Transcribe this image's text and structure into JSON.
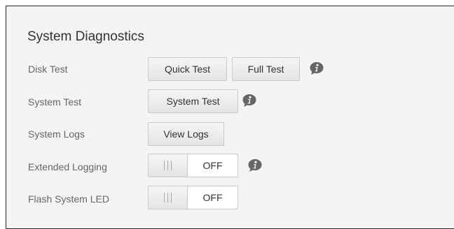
{
  "panel": {
    "title": "System Diagnostics"
  },
  "rows": {
    "disk_test": {
      "label": "Disk Test",
      "quick_test_label": "Quick Test",
      "full_test_label": "Full Test",
      "info_icon": "info-icon"
    },
    "system_test": {
      "label": "System Test",
      "button_label": "System Test",
      "info_icon": "info-icon"
    },
    "system_logs": {
      "label": "System Logs",
      "button_label": "View Logs"
    },
    "extended_logging": {
      "label": "Extended Logging",
      "state": "OFF",
      "info_icon": "info-icon"
    },
    "flash_system_led": {
      "label": "Flash System LED",
      "state": "OFF"
    }
  },
  "colors": {
    "panel_background": "#f4f4f4",
    "label_text": "#666666",
    "button_text": "#333333",
    "button_border": "#c9c9c9",
    "info_icon": "#666666"
  }
}
